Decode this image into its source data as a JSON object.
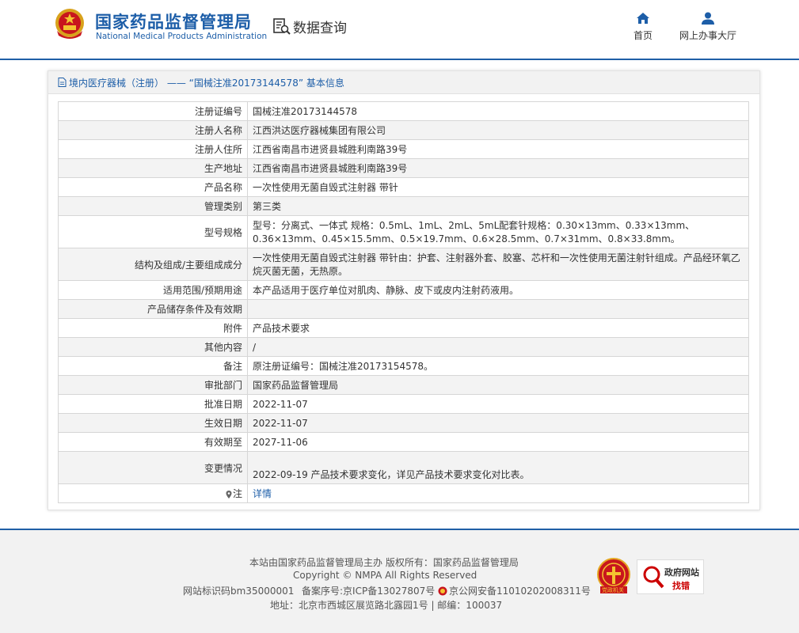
{
  "header": {
    "logo_cn": "国家药品监督管理局",
    "logo_en": "National Medical Products Administration",
    "query_label": "数据查询",
    "nav": [
      {
        "label": "首页",
        "icon": "home-icon"
      },
      {
        "label": "网上办事大厅",
        "icon": "user-icon"
      }
    ]
  },
  "breadcrumb": "境内医疗器械（注册） —— “国械注准20173144578” 基本信息",
  "details": {
    "rows": [
      {
        "label": "注册证编号",
        "value": "国械注准20173144578"
      },
      {
        "label": "注册人名称",
        "value": "江西洪达医疗器械集团有限公司"
      },
      {
        "label": "注册人住所",
        "value": "江西省南昌市进贤县城胜利南路39号"
      },
      {
        "label": "生产地址",
        "value": "江西省南昌市进贤县城胜利南路39号"
      },
      {
        "label": "产品名称",
        "value": "一次性使用无菌自毁式注射器 带针"
      },
      {
        "label": "管理类别",
        "value": "第三类"
      },
      {
        "label": "型号规格",
        "value": "型号：分离式、一体式 规格：0.5mL、1mL、2mL、5mL配套针规格：0.30×13mm、0.33×13mm、0.36×13mm、0.45×15.5mm、0.5×19.7mm、0.6×28.5mm、0.7×31mm、0.8×33.8mm。"
      },
      {
        "label": "结构及组成/主要组成成分",
        "value": "一次性使用无菌自毁式注射器 带针由：护套、注射器外套、胶塞、芯杆和一次性使用无菌注射针组成。产品经环氧乙烷灭菌无菌，无热原。"
      },
      {
        "label": "适用范围/预期用途",
        "value": "本产品适用于医疗单位对肌肉、静脉、皮下或皮内注射药液用。"
      },
      {
        "label": "产品储存条件及有效期",
        "value": ""
      },
      {
        "label": "附件",
        "value": "产品技术要求"
      },
      {
        "label": "其他内容",
        "value": "/"
      },
      {
        "label": "备注",
        "value": "原注册证编号：国械注准20173154578。"
      },
      {
        "label": "审批部门",
        "value": "国家药品监督管理局"
      },
      {
        "label": "批准日期",
        "value": "2022-11-07"
      },
      {
        "label": "生效日期",
        "value": "2022-11-07"
      },
      {
        "label": "有效期至",
        "value": "2027-11-06"
      },
      {
        "label": "变更情况",
        "value": "2022-09-19 产品技术要求变化，详见产品技术要求变化对比表。"
      }
    ],
    "note_label": "注",
    "note_link": "详情"
  },
  "footer": {
    "line1": "本站由国家药品监督管理局主办 版权所有：国家药品监督管理局",
    "line2": "Copyright © NMPA All Rights Reserved",
    "site_id": "网站标识码bm35000001",
    "icp": "备案序号:京ICP备13027807号",
    "police": "京公网安备11010202008311号",
    "address": "地址：北京市西城区展览路北露园1号 | 邮编：100037",
    "badge1_text": "党政机关",
    "badge2_title": "政府网站",
    "badge2_sub": "找错"
  },
  "colors": {
    "brand_blue": "#1d5ea8",
    "row_alt": "#f3f3f3",
    "footer_bg": "#f2f2f2"
  }
}
